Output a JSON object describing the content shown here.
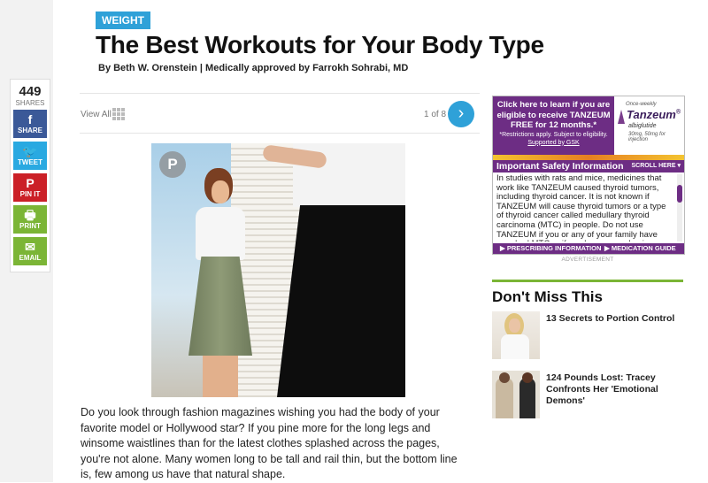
{
  "share": {
    "count": "449",
    "count_label": "SHARES",
    "buttons": [
      {
        "label": "SHARE",
        "icon": "f"
      },
      {
        "label": "TWEET",
        "icon": "🐦"
      },
      {
        "label": "PIN IT",
        "icon": "P"
      },
      {
        "label": "PRINT",
        "icon": "🖶"
      },
      {
        "label": "EMAIL",
        "icon": "✉"
      }
    ]
  },
  "article": {
    "category": "WEIGHT",
    "title": "The Best Workouts for Your Body Type",
    "byline": "By Beth W. Orenstein | Medically approved by Farrokh Sohrabi, MD",
    "view_all": "View All",
    "pager": "1 of 8",
    "next_icon": "›",
    "pin_icon": "P",
    "body": "Do you look through fashion magazines wishing you had the body of your favorite model or Hollywood star? If you pine more for the long legs and winsome waistlines than for the latest clothes splashed across the pages, you're not alone. Many women long to be tall and rail thin, but the bottom line is, few among us have that natural shape."
  },
  "ad": {
    "headline": "Click here to learn if you are eligible to receive TANZEUM FREE for 12 months.*",
    "fine_print": "*Restrictions apply. Subject to eligibility.",
    "support": "Supported by GSK",
    "brand_sub": "Once-weekly",
    "brand_name": "Tanzeum",
    "brand_reg": "®",
    "brand_generic": "albiglutide",
    "brand_dose": "30mg, 50mg for injection",
    "isi_title": "Important Safety Information",
    "isi_scroll": "SCROLL HERE ▾",
    "isi_text": "In studies with rats and mice, medicines that work like TANZEUM caused thyroid tumors, including thyroid cancer. It is not known if TANZEUM will cause thyroid tumors or a type of thyroid cancer called medullary thyroid carcinoma (MTC) in people. Do not use TANZEUM if you or any of your family have ever had MTC or if you have an endocrine system",
    "link_prescribing": "▶ PRESCRIBING INFORMATION",
    "link_guide": "▶ MEDICATION GUIDE",
    "label": "ADVERTISEMENT"
  },
  "dont_miss": {
    "title": "Don't Miss This",
    "items": [
      {
        "text": "13 Secrets to Portion Control"
      },
      {
        "text": "124 Pounds Lost: Tracey Confronts Her 'Emotional Demons'"
      }
    ]
  },
  "colors": {
    "accent": "#2fa1d8",
    "facebook": "#3b5998",
    "twitter": "#29a9e1",
    "pinterest": "#cb2027",
    "green": "#7bb536",
    "ad_purple": "#6d2d84"
  }
}
